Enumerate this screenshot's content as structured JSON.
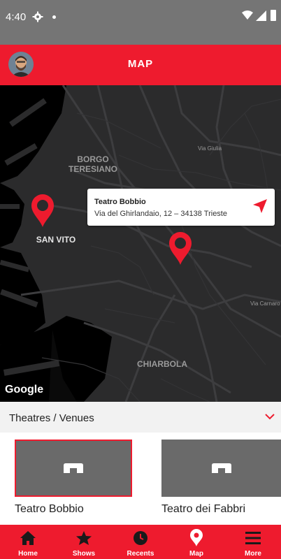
{
  "status_bar": {
    "time": "4:40"
  },
  "app_bar": {
    "title": "MAP"
  },
  "map": {
    "labels": {
      "borgo_teresiano": "BORGO\nTERESIANO",
      "san_vito": "SAN VITO",
      "chiarbola": "CHIARBOLA",
      "via_giulia": "Via Giulia",
      "via_carnaro": "Via Carnaro"
    },
    "info_window": {
      "name": "Teatro Bobbio",
      "address": "Via del Ghirlandaio, 12 – 34138 Trieste"
    },
    "attribution": "Google",
    "pin_color": "#EE1B2E"
  },
  "section": {
    "label": "Theatres / Venues"
  },
  "venues": [
    {
      "name": "Teatro Bobbio",
      "selected": true
    },
    {
      "name": "Teatro dei Fabbri",
      "selected": false
    }
  ],
  "tabs": [
    {
      "label": "Home",
      "icon": "home-icon"
    },
    {
      "label": "Shows",
      "icon": "star-icon"
    },
    {
      "label": "Recents",
      "icon": "clock-icon"
    },
    {
      "label": "Map",
      "icon": "map-pin-icon"
    },
    {
      "label": "More",
      "icon": "menu-icon"
    }
  ],
  "colors": {
    "brand": "#EE1B2E",
    "map_bg": "#2b2b2c",
    "status_bar": "#757575"
  }
}
